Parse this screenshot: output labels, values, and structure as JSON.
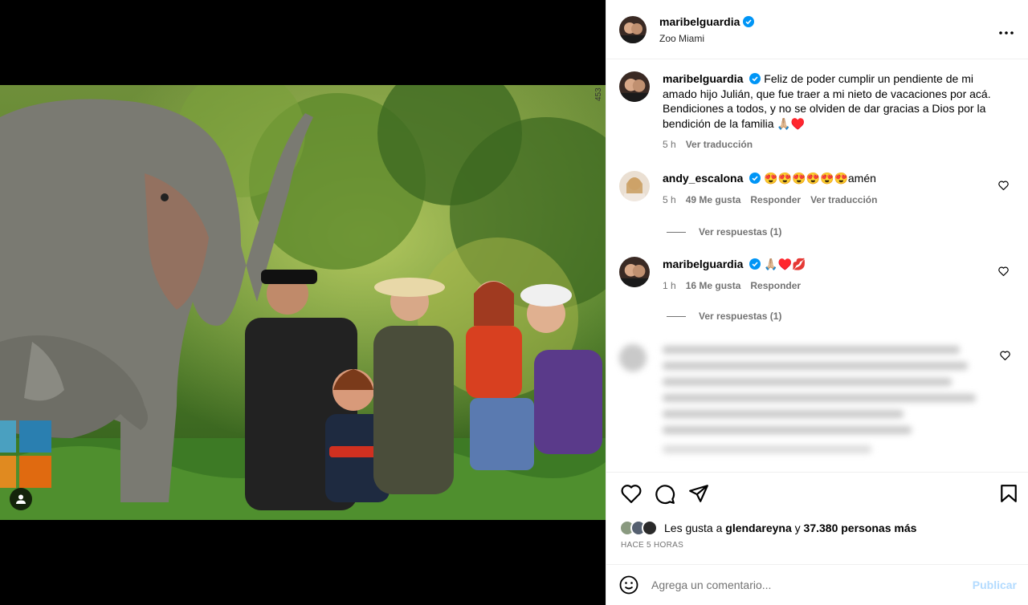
{
  "post": {
    "author": "maribelguardia",
    "location": "Zoo Miami",
    "more_icon": "ellipsis-icon",
    "photo_corner_mark": "453"
  },
  "caption": {
    "username": "maribelguardia",
    "text": "Feliz de poder cumplir un pendiente de mi amado hijo Julián, que fue traer a mi nieto de vacaciones por acá. Bendiciones a todos, y no se olviden de dar gracias a Dios por la bendición de la familia 🙏🏼♥️",
    "time": "5 h",
    "translate": "Ver traducción"
  },
  "comments": [
    {
      "username": "andy_escalona",
      "text": "😍😍😍😍😍😍amén",
      "time": "5 h",
      "likes": "49 Me gusta",
      "reply": "Responder",
      "translate": "Ver traducción",
      "view_replies": "Ver respuestas (1)"
    },
    {
      "username": "maribelguardia",
      "text": "🙏🏼♥️💋",
      "time": "1 h",
      "likes": "16 Me gusta",
      "reply": "Responder",
      "view_replies": "Ver respuestas (1)"
    }
  ],
  "likes": {
    "prefix": "Les gusta a",
    "user": "glendareyna",
    "joiner": "y",
    "count": "37.380 personas más"
  },
  "timestamp": "HACE 5 HORAS",
  "composer": {
    "placeholder": "Agrega un comentario...",
    "publish": "Publicar"
  },
  "colors": {
    "verified": "#0095f6",
    "muted": "#737373",
    "publish_disabled": "#b3dbff"
  }
}
